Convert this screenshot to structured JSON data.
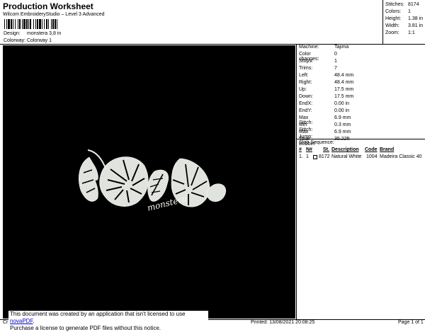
{
  "header": {
    "title": "Production Worksheet",
    "subtitle": "Wilcom EmbroideryStudio – Level 3 Advanced",
    "design_label": "Design:",
    "design_value": "monstera 3,8 in",
    "colorway_label": "Colorway:",
    "colorway_value": "Colorway 1"
  },
  "top_stats": [
    {
      "label": "Stitches:",
      "value": "8174"
    },
    {
      "label": "Colors:",
      "value": "1"
    },
    {
      "label": "Height:",
      "value": "1.38 in"
    },
    {
      "label": "Width:",
      "value": "3.81 in"
    },
    {
      "label": "Zoom:",
      "value": "1:1"
    }
  ],
  "machine_stats": [
    {
      "label": "Machine:",
      "value": "Tajima"
    },
    {
      "label": "Color changes:",
      "value": "0"
    },
    {
      "label": "Stops:",
      "value": "1"
    },
    {
      "label": "Trims:",
      "value": "7"
    },
    {
      "label": "Left:",
      "value": "48.4 mm"
    },
    {
      "label": "Right:",
      "value": "48.4 mm"
    },
    {
      "label": "Up:",
      "value": "17.5 mm"
    },
    {
      "label": "Down:",
      "value": "17.5 mm"
    },
    {
      "label": "EndX:",
      "value": "0.00 in"
    },
    {
      "label": "EndY:",
      "value": "0.00 in"
    },
    {
      "label": "Max Stitch:",
      "value": "6.9 mm"
    },
    {
      "label": "Min Stitch:",
      "value": "0.3 mm"
    },
    {
      "label": "Max Jump:",
      "value": "6.9 mm"
    },
    {
      "label": "Total Bobbin:",
      "value": "35.22ft"
    }
  ],
  "stop_sequence": {
    "title": "Stop Sequence:",
    "headers": {
      "num": "#",
      "n": "N#",
      "st": "St.",
      "description": "Description",
      "code": "Code",
      "brand": "Brand"
    },
    "rows": [
      {
        "num": "1.",
        "n": "1",
        "st": "8172",
        "description": "Natural White",
        "code": "1004",
        "brand": "Madeira Classic 40",
        "swatch_color": "#f2f2ea"
      }
    ]
  },
  "design_preview": {
    "text": "monstera",
    "background": "#000000",
    "thread_color": "#e8ebe6"
  },
  "notice": {
    "line1_prefix": "This document was created by an application that isn't licensed to use ",
    "link": "novaPDF",
    "line1_suffix": ".",
    "line2": "Purchase a license to generate PDF files without this notice."
  },
  "footer": {
    "left": "Cr",
    "printed": "Printed: 13/08/2021 20:08:25",
    "page": "Page 1 of 1"
  }
}
